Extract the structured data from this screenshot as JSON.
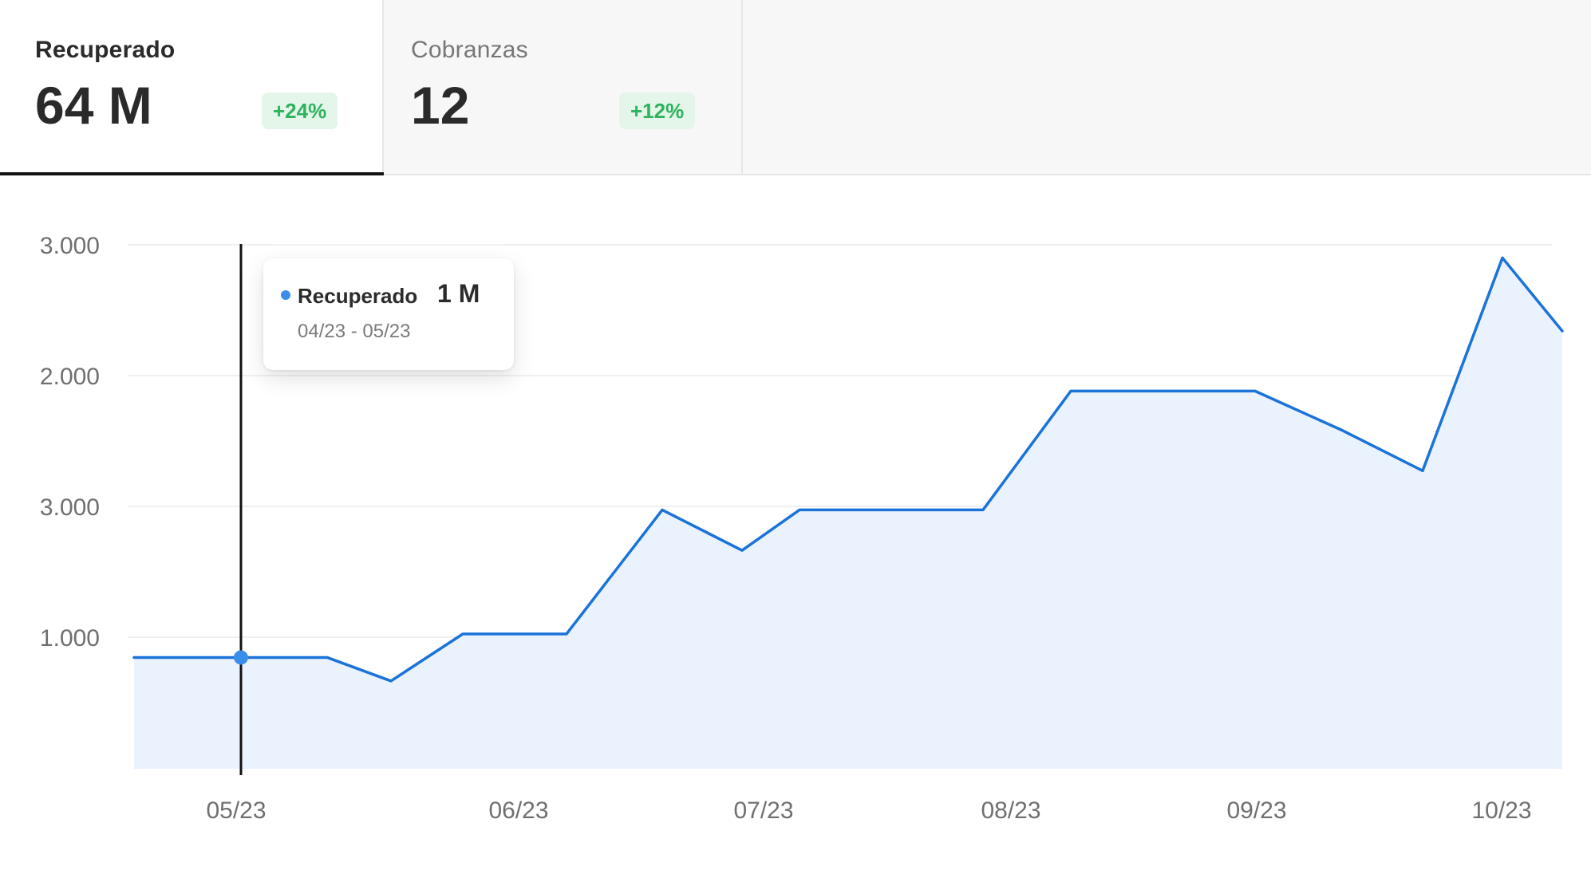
{
  "tabs": [
    {
      "label": "Recuperado",
      "value": "64 M",
      "change": "+24%",
      "active": true
    },
    {
      "label": "Cobranzas",
      "value": "12",
      "change": "+12%",
      "active": false
    }
  ],
  "tooltip": {
    "series": "Recuperado",
    "value": "1 M",
    "range": "04/23 - 05/23"
  },
  "colors": {
    "line": "#1a73d9",
    "area": "#eaf2fd",
    "badge_bg": "#e3f6e9",
    "badge_text": "#2fb35e",
    "cursor": "#111111",
    "marker": "#3a8eea"
  },
  "chart_data": {
    "type": "area",
    "title": "",
    "xlabel": "",
    "ylabel": "",
    "grid": true,
    "y_tick_labels": [
      "3.000",
      "2.000",
      "3.000",
      "1.000"
    ],
    "x_tick_labels": [
      "05/23",
      "06/23",
      "07/23",
      "08/23",
      "09/23",
      "10/23"
    ],
    "series": [
      {
        "name": "Recuperado",
        "points": [
          {
            "x": "04/23",
            "y": 840
          },
          {
            "x": "05/23",
            "y": 840
          },
          {
            "x": "05/23",
            "y": 840
          },
          {
            "x": "05/23",
            "y": 660
          },
          {
            "x": "05/23",
            "y": 1020
          },
          {
            "x": "06/23",
            "y": 1020
          },
          {
            "x": "06/23",
            "y": 1970
          },
          {
            "x": "06/23",
            "y": 1660
          },
          {
            "x": "07/23",
            "y": 1970
          },
          {
            "x": "07/23",
            "y": 1970
          },
          {
            "x": "08/23",
            "y": 2880
          },
          {
            "x": "08/23",
            "y": 2880
          },
          {
            "x": "09/23",
            "y": 2580
          },
          {
            "x": "09/23",
            "y": 2270
          },
          {
            "x": "10/23",
            "y": 3900
          },
          {
            "x": "10/23",
            "y": 3340
          }
        ]
      }
    ],
    "y_data_range": [
      0,
      4000
    ],
    "highlight": {
      "series": "Recuperado",
      "x": "05/23",
      "y": 840
    }
  }
}
